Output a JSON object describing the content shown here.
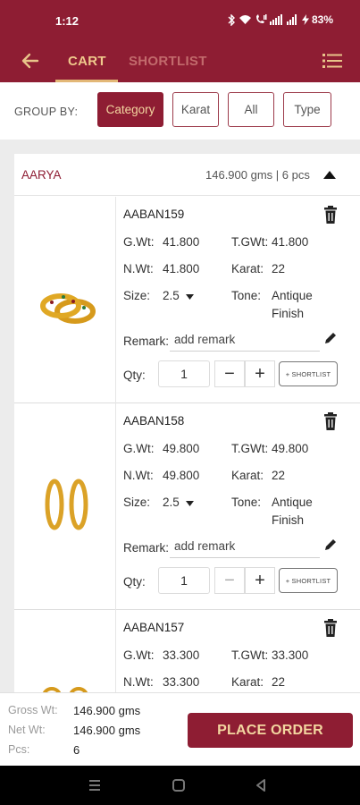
{
  "status": {
    "time": "1:12",
    "battery": "83%"
  },
  "tabs": [
    {
      "label": "CART"
    },
    {
      "label": "SHORTLIST"
    }
  ],
  "group_by": {
    "label": "GROUP BY:",
    "options": [
      {
        "label": "Category",
        "active": true
      },
      {
        "label": "Karat",
        "active": false
      },
      {
        "label": "All",
        "active": false
      },
      {
        "label": "Type",
        "active": false
      }
    ]
  },
  "group": {
    "name": "AARYA",
    "summary": "146.900 gms | 6 pcs"
  },
  "labels": {
    "gwt": "G.Wt:",
    "tgwt": "T.GWt:",
    "nwt": "N.Wt:",
    "karat": "Karat:",
    "size": "Size:",
    "tone": "Tone:",
    "remark": "Remark:",
    "qty": "Qty:",
    "remark_placeholder": "add remark",
    "shortlist_btn": "+ SHORTLIST"
  },
  "items": [
    {
      "code": "AABAN159",
      "gwt": "41.800",
      "tgwt": "41.800",
      "nwt": "41.800",
      "karat": "22",
      "size": "2.5",
      "tone_line1": "Antique",
      "tone_line2": "Finish",
      "remark": "add remark",
      "qty": "1"
    },
    {
      "code": "AABAN158",
      "gwt": "49.800",
      "tgwt": "49.800",
      "nwt": "49.800",
      "karat": "22",
      "size": "2.5",
      "tone_line1": "Antique",
      "tone_line2": "Finish",
      "remark": "add remark",
      "qty": "1"
    },
    {
      "code": "AABAN157",
      "gwt": "33.300",
      "tgwt": "33.300",
      "nwt": "33.300",
      "karat": "22"
    }
  ],
  "summary": {
    "gross_label": "Gross Wt:",
    "gross_value": "146.900 gms",
    "net_label": "Net Wt:",
    "net_value": "146.900 gms",
    "pcs_label": "Pcs:",
    "pcs_value": "6"
  },
  "place_order_label": "PLACE ORDER",
  "colors": {
    "brand": "#8e1d33",
    "accent": "#f0c98c",
    "inactive_tab": "#c26a6c"
  }
}
